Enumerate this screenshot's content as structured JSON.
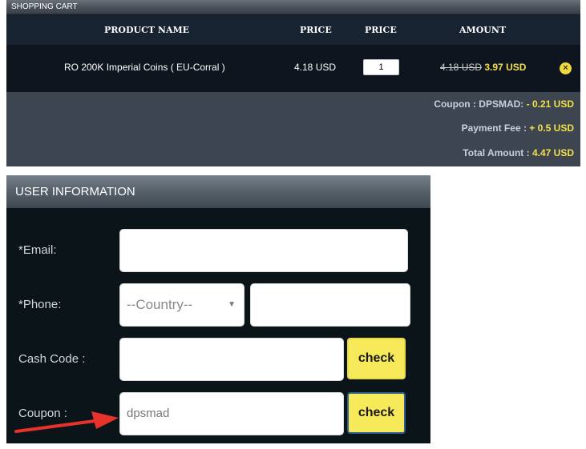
{
  "cart": {
    "header": "SHOPPING CART",
    "columns": {
      "name": "PRODUCT NAME",
      "price": "PRICE",
      "qty": "PRICE",
      "amount": "AMOUNT"
    },
    "item": {
      "name": "RO 200K Imperial Coins ( EU-Corral )",
      "price": "4.18 USD",
      "quantity": "1",
      "old_amount": "4.18 USD",
      "new_amount": "3.97 USD"
    },
    "summary": {
      "coupon_label": "Coupon : DPSMAD:",
      "coupon_value": "- 0.21 USD",
      "fee_label": "Payment Fee :",
      "fee_value": "+ 0.5 USD",
      "total_label": "Total Amount :",
      "total_value": "4.47 USD"
    }
  },
  "user": {
    "header": "USER INFORMATION",
    "email_label": "*Email:",
    "email_value": "",
    "phone_label": "*Phone:",
    "country_select": "--Country--",
    "phone_value": "",
    "cash_label": "Cash Code :",
    "cash_value": "",
    "cash_check": "check",
    "coupon_label": "Coupon :",
    "coupon_value": "dpsmad",
    "coupon_check": "check"
  },
  "colors": {
    "accent_yellow": "#f3e04a",
    "annotation_red": "#e8322c"
  }
}
